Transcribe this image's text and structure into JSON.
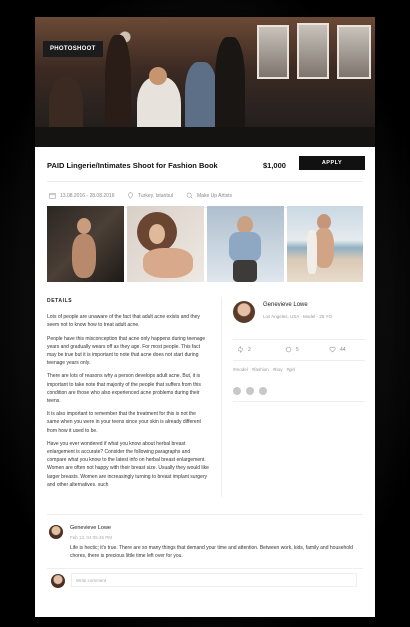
{
  "hero": {
    "badge": "PHOTOSHOOT"
  },
  "job": {
    "title": "PAID Lingerie/Intimates Shoot for Fashion Book",
    "price": "$1,000",
    "apply_label": "APPLY",
    "dates": "13.08.2016 - 28.08.2016",
    "location": "Turkey, Istanbul",
    "role": "Make Up Artists"
  },
  "details": {
    "heading": "DETAILS",
    "paragraphs": [
      "Lots of people are unaware of the fact that adult acne exists and they seem not to know how to treat adult acne.",
      "People have this misconception that acne only happens during teenage years and gradually wears off as they age. For most people. This fact may be true but it is important to note that acne does not start during teenage years only.",
      "There are lots of reasons why a person develops adult acne. But, it is important to take note that majority of the people that suffers from this condition are those who also experienced acne problems during their teens.",
      "It is also important to remember that the treatment for this is not the same when you were in your teens since your skin is already different from how it used to be.",
      "Have you ever wondered if what you know about herbal breast enlargement is accurate? Consider the following paragraphs and compare what you know to the latest info on herbal breast enlargement. Women are often not happy with their breast size. Usually they would like larger breasts. Women are increasingly turning to breast implant surgery and other alternatives. such"
    ]
  },
  "profile": {
    "name": "Genevieve Lowe",
    "info": "Los Angeles, USA · Model · 25 YO",
    "shares": "2",
    "comments": "5",
    "likes": "44",
    "tags": [
      "#model",
      "#fashion",
      "#boy",
      "#girl"
    ]
  },
  "comment": {
    "name": "Genevieve Lowe",
    "time": "Feb 13, 04:05:45 PM",
    "text": "Life is hectic; it's true. There are so many things that demand your time and attention. Between work, kids, family and household chores, there is precious little time left over for you."
  },
  "write_comment": {
    "placeholder": "Write comment"
  },
  "icons": {
    "calendar": "calendar-icon",
    "location": "location-pin-icon",
    "search": "search-icon",
    "share": "share-icon",
    "comment": "comment-icon",
    "heart": "heart-icon",
    "facebook": "facebook-icon",
    "twitter": "twitter-icon",
    "instagram": "instagram-icon"
  }
}
